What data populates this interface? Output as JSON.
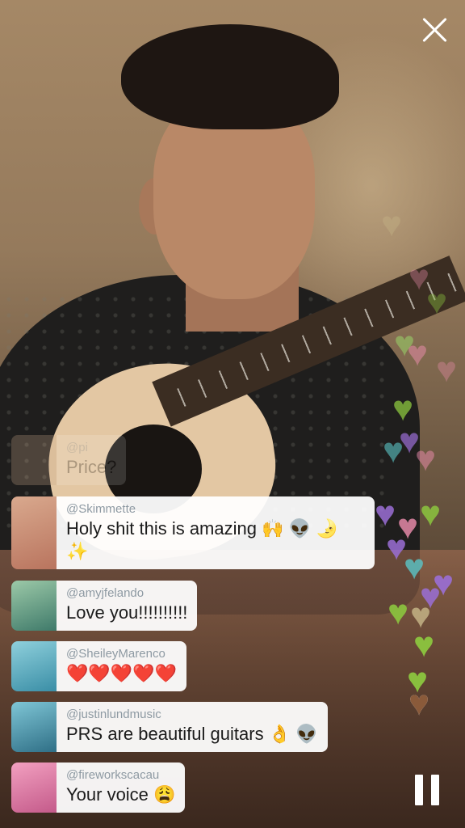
{
  "controls": {
    "close_icon": "close-icon",
    "pause_icon": "pause-icon"
  },
  "faded_comment": {
    "username": "@pi",
    "message": "Price?"
  },
  "comments": [
    {
      "username": "@Skimmette",
      "message": "Holy shit this is amazing 🙌 👽 🌛",
      "message_line2": "✨"
    },
    {
      "username": "@amyjfelando",
      "message": "Love you!!!!!!!!!!"
    },
    {
      "username": "@SheileyMarenco",
      "message": "❤️❤️❤️❤️❤️"
    },
    {
      "username": "@justinlundmusic",
      "message": "PRS are beautiful guitars 👌 👽"
    },
    {
      "username": "@fireworkscacau",
      "message": "Your voice 😩"
    }
  ],
  "colors": {
    "heart_green": "#8cc63f",
    "heart_pink": "#f08fb0",
    "heart_purple": "#9b6fd6",
    "heart_teal": "#5bc6c8",
    "heart_brown": "#8a5a3a",
    "username_gray": "#8e9aa3"
  }
}
